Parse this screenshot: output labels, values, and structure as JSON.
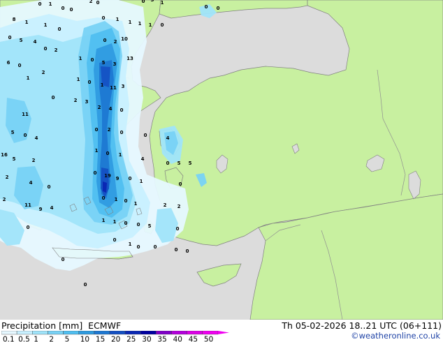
{
  "title": {
    "product": "Precipitation [mm]",
    "model": "ECMWF",
    "valid_time": "Th 05-02-2026 18..21 UTC (06+111)",
    "credit": "©weatheronline.co.uk"
  },
  "legend": {
    "ticks": [
      "0.1",
      "0.5",
      "1",
      "2",
      "5",
      "10",
      "15",
      "20",
      "25",
      "30",
      "35",
      "40",
      "45",
      "50"
    ],
    "colors": [
      "#e6f8ff",
      "#c8f0ff",
      "#a0e4fa",
      "#78d2f5",
      "#50bff0",
      "#2f9be0",
      "#1e78d2",
      "#1450c3",
      "#0a28b4",
      "#0000a0",
      "#8000c8",
      "#b400dc",
      "#dc00e6",
      "#f000f0"
    ]
  },
  "colors": {
    "sea": "#dcdcdc",
    "land": "#c8f0a0",
    "border": "#909090",
    "coast": "#808080"
  },
  "map_numbers": [
    "0",
    "1",
    "0",
    "0",
    "2",
    "0",
    "0",
    "3",
    "1",
    "0",
    "0",
    "8",
    "1",
    "1",
    "0",
    "0",
    "1",
    "1",
    "1",
    "1",
    "0",
    "0",
    "5",
    "4",
    "0",
    "2",
    "0",
    "2",
    "10",
    "6",
    "0",
    "1",
    "0",
    "5",
    "3",
    "13",
    "2",
    "1",
    "0",
    "1",
    "11",
    "3",
    "1",
    "0",
    "2",
    "3",
    "2",
    "4",
    "0",
    "11",
    "5",
    "0",
    "4",
    "0",
    "2",
    "0",
    "0",
    "4",
    "16",
    "5",
    "2",
    "1",
    "0",
    "1",
    "4",
    "0",
    "5",
    "5",
    "2",
    "4",
    "0",
    "0",
    "19",
    "9",
    "0",
    "1",
    "0",
    "2",
    "11",
    "9",
    "4",
    "0",
    "1",
    "0",
    "1",
    "2",
    "2",
    "1",
    "1",
    "0",
    "0",
    "5",
    "0",
    "0",
    "0",
    "1",
    "0",
    "0",
    "0",
    "0",
    "0",
    "0",
    "0",
    "0"
  ]
}
